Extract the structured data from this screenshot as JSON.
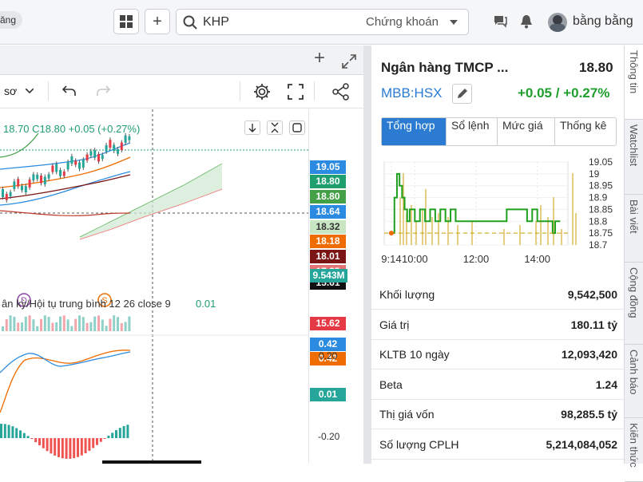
{
  "header": {
    "left_pill": "ăng",
    "search_value": "KHP",
    "search_category": "Chứng khoán",
    "username": "bằng bằng"
  },
  "chart_panel": {
    "interval_label": "sơ",
    "ohlc_text": "18.70  C18.80 +0.05 (+0.27%)",
    "price_tags": [
      {
        "text": "19.05",
        "color": "#2a8be0"
      },
      {
        "text": "18.80",
        "color": "#1f9e6e"
      },
      {
        "text": "18.80",
        "color": "#43a047"
      },
      {
        "text": "18.64",
        "color": "#2a8be0"
      },
      {
        "text": "18.32",
        "color": "#c9e6c3"
      },
      {
        "text": "18.18",
        "color": "#ef6c00"
      },
      {
        "text": "18.01",
        "color": "#7b1414"
      },
      {
        "text": "17.35",
        "color": "#e57373"
      },
      {
        "text": "15.61",
        "color": "#111111"
      },
      {
        "text": "15.62",
        "color": "#e53945"
      }
    ],
    "volume_tag": "9.543M",
    "volume_tag_color": "#26a69a",
    "macd_legend": "ân kỳ/Hội tụ trung bình 12 26 close 9",
    "macd_value": "0.01",
    "macd_tags": [
      {
        "text": "0.42",
        "color": "#2a8be0"
      },
      {
        "text": "0.42",
        "color": "#ef6c00"
      }
    ],
    "macd_axis": [
      "0.20",
      "0.01",
      "-0.20"
    ],
    "macd_hist_tag_color": "#26a69a",
    "marker_d": "D",
    "marker_s": "S"
  },
  "stock": {
    "name": "Ngân hàng TMCP ...",
    "price": "18.80",
    "ticker": "MBB:HSX",
    "change": "+0.05 / +0.27%"
  },
  "tabs": [
    {
      "label": "Tổng hợp",
      "active": true
    },
    {
      "label": "Sổ lệnh",
      "active": false
    },
    {
      "label": "Mức giá",
      "active": false
    },
    {
      "label": "Thống kê",
      "active": false
    }
  ],
  "chart_data": {
    "type": "line",
    "title": "",
    "xlabel": "",
    "ylabel": "",
    "x_ticks": [
      "9:14",
      "10:00",
      "12:00",
      "14:00"
    ],
    "y_ticks": [
      "19.05",
      "19",
      "18.95",
      "18.9",
      "18.85",
      "18.8",
      "18.75",
      "18.7"
    ],
    "ylim": [
      18.7,
      19.05
    ],
    "reference_price": 18.75,
    "series": [
      {
        "color": "#1fa01f",
        "x": [
          "9:14",
          "9:20",
          "9:25",
          "9:30",
          "9:35",
          "9:40",
          "9:45",
          "9:50",
          "10:00",
          "10:10",
          "10:20",
          "10:30",
          "10:40",
          "10:50",
          "11:00",
          "11:10",
          "11:20",
          "11:30",
          "13:00",
          "13:30",
          "13:40",
          "13:50",
          "14:00",
          "14:10",
          "14:20",
          "14:30",
          "14:35",
          "14:40",
          "14:45"
        ],
        "values": [
          18.75,
          18.9,
          19.0,
          18.95,
          18.9,
          18.85,
          18.8,
          18.85,
          18.8,
          18.85,
          18.8,
          18.85,
          18.8,
          18.85,
          18.8,
          18.85,
          18.8,
          18.8,
          18.85,
          18.85,
          18.8,
          18.85,
          18.8,
          18.8,
          18.8,
          18.75,
          18.8,
          18.8,
          18.8
        ]
      }
    ]
  },
  "stats": [
    {
      "label": "Khối lượng",
      "value": "9,542,500"
    },
    {
      "label": "Giá trị",
      "value": "180.11 tỷ"
    },
    {
      "label": "KLTB 10 ngày",
      "value": "12,093,420"
    },
    {
      "label": "Beta",
      "value": "1.24"
    },
    {
      "label": "Thị giá vốn",
      "value": "98,285.5 tỷ"
    },
    {
      "label": "Số lượng CPLH",
      "value": "5,214,084,052"
    }
  ],
  "side_tabs": [
    "Thông tin",
    "Watchlist",
    "Bài viết",
    "Cộng đồng",
    "Cảnh báo",
    "Kiến thức"
  ]
}
